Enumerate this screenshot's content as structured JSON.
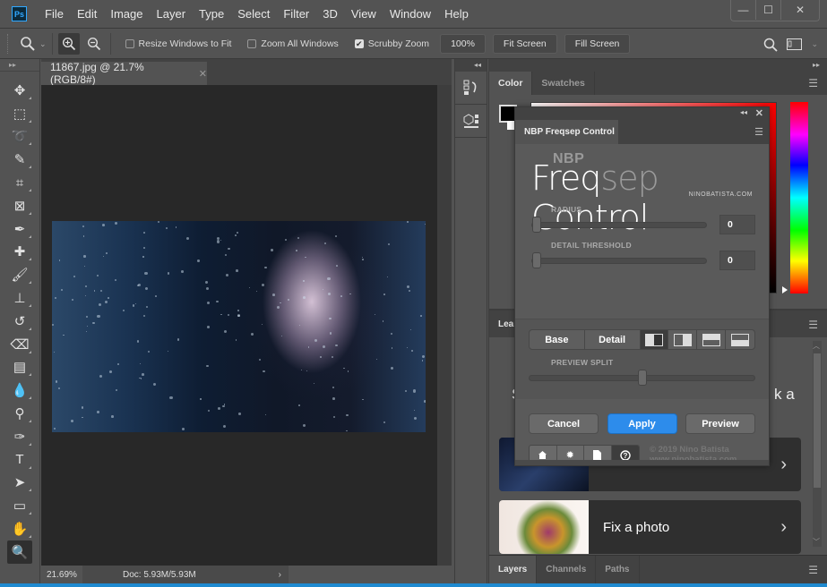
{
  "app": {
    "logo_text": "Ps",
    "menu": [
      "File",
      "Edit",
      "Image",
      "Layer",
      "Type",
      "Select",
      "Filter",
      "3D",
      "View",
      "Window",
      "Help"
    ],
    "window_controls": {
      "minimize": "—",
      "maximize": "☐",
      "close": "✕"
    }
  },
  "options_bar": {
    "tool_icon": "zoom-icon",
    "zoom_in_icon": "zoom-in-icon",
    "zoom_out_icon": "zoom-out-icon",
    "checkboxes": [
      {
        "label": "Resize Windows to Fit",
        "checked": false
      },
      {
        "label": "Zoom All Windows",
        "checked": false
      },
      {
        "label": "Scrubby Zoom",
        "checked": true
      }
    ],
    "buttons": [
      "100%",
      "Fit Screen",
      "Fill Screen"
    ],
    "search_icon": "search-icon",
    "workspace_icon": "workspace-icon"
  },
  "toolbar": {
    "tools": [
      {
        "name": "move-tool",
        "glyph": "✥"
      },
      {
        "name": "marquee-tool",
        "glyph": "⬚"
      },
      {
        "name": "lasso-tool",
        "glyph": "➰"
      },
      {
        "name": "quick-selection-tool",
        "glyph": "✎"
      },
      {
        "name": "crop-tool",
        "glyph": "⌗"
      },
      {
        "name": "frame-tool",
        "glyph": "⊠"
      },
      {
        "name": "eyedropper-tool",
        "glyph": "✒"
      },
      {
        "name": "healing-brush-tool",
        "glyph": "✚"
      },
      {
        "name": "brush-tool",
        "glyph": "🖌"
      },
      {
        "name": "clone-stamp-tool",
        "glyph": "⊥"
      },
      {
        "name": "history-brush-tool",
        "glyph": "↺"
      },
      {
        "name": "eraser-tool",
        "glyph": "⌫"
      },
      {
        "name": "gradient-tool",
        "glyph": "▤"
      },
      {
        "name": "blur-tool",
        "glyph": "💧"
      },
      {
        "name": "dodge-tool",
        "glyph": "⚲"
      },
      {
        "name": "pen-tool",
        "glyph": "✑"
      },
      {
        "name": "type-tool",
        "glyph": "T"
      },
      {
        "name": "path-selection-tool",
        "glyph": "➤"
      },
      {
        "name": "rectangle-tool",
        "glyph": "▭"
      },
      {
        "name": "hand-tool",
        "glyph": "✋"
      },
      {
        "name": "zoom-tool",
        "glyph": "🔍",
        "active": true
      }
    ]
  },
  "document": {
    "tab_title": "11867.jpg @ 21.7% (RGB/8#)",
    "close_glyph": "✕",
    "zoom_readout": "21.69%",
    "doc_size": "Doc: 5.93M/5.93M"
  },
  "color_panel": {
    "tabs": [
      "Color",
      "Swatches"
    ],
    "active_tab": "Color",
    "foreground": "#000000",
    "background": "#ffffff",
    "hue": "#ff0000"
  },
  "learn_panel": {
    "tab_label": "Lear",
    "heading_left_fragment": "S",
    "heading_right_fragment": "k a",
    "cards": [
      {
        "title": "",
        "occluded": true
      },
      {
        "title": "Fix a photo"
      }
    ],
    "chevron": "›"
  },
  "layers_panel": {
    "tabs": [
      "Layers",
      "Channels",
      "Paths"
    ],
    "active_tab": "Layers"
  },
  "nbp_dialog": {
    "tab_title": "NBP Freqsep Control",
    "logo": {
      "small": "NBP",
      "word1": "Freq",
      "word2": "sep",
      "word3": " Control",
      "site": "NINOBATISTA.COM"
    },
    "radius": {
      "label": "RADIUS",
      "value": "0",
      "fraction": 0
    },
    "detail_threshold": {
      "label": "DETAIL THRESHOLD",
      "value": "0",
      "fraction": 0
    },
    "segments": [
      "Base",
      "Detail"
    ],
    "split_modes": [
      "split-vertical-left",
      "split-vertical-right",
      "split-horizontal-bottom",
      "split-horizontal-top"
    ],
    "active_split_mode": 0,
    "preview_split": {
      "label": "PREVIEW SPLIT",
      "fraction": 0.5
    },
    "buttons": {
      "cancel": "Cancel",
      "apply": "Apply",
      "preview": "Preview"
    },
    "footer_icons": [
      "home-icon",
      "gear-icon",
      "document-icon",
      "help-icon"
    ],
    "copyright_line1": "© 2019 Nino Batista",
    "copyright_line2": "www.ninobatista.com",
    "accent": "#2d8ceb"
  }
}
